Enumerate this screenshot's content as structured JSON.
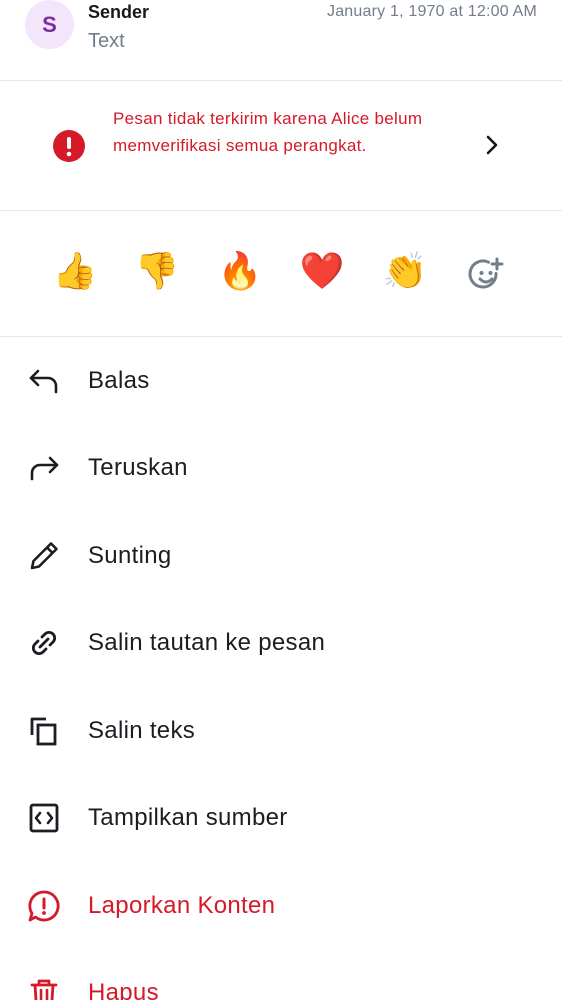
{
  "header": {
    "avatar_letter": "S",
    "sender": "Sender",
    "timestamp": "January 1, 1970 at 12:00 AM",
    "preview": "Text"
  },
  "warning": {
    "text": "Pesan tidak terkirim karena Alice belum memverifikasi semua perangkat."
  },
  "reactions": [
    {
      "emoji": "👍",
      "name": "thumbs-up"
    },
    {
      "emoji": "👎",
      "name": "thumbs-down"
    },
    {
      "emoji": "🔥",
      "name": "fire"
    },
    {
      "emoji": "❤️",
      "name": "red-heart"
    },
    {
      "emoji": "👏",
      "name": "clapping-hands"
    }
  ],
  "menu": {
    "reply": "Balas",
    "forward": "Teruskan",
    "edit": "Sunting",
    "copy_link": "Salin tautan ke pesan",
    "copy_text": "Salin teks",
    "view_source": "Tampilkan sumber",
    "report": "Laporkan Konten",
    "delete": "Hapus"
  },
  "colors": {
    "danger": "#d51928",
    "secondary_text": "#737d8c",
    "avatar_bg": "#f3e6fb",
    "avatar_fg": "#7a2ea0"
  }
}
